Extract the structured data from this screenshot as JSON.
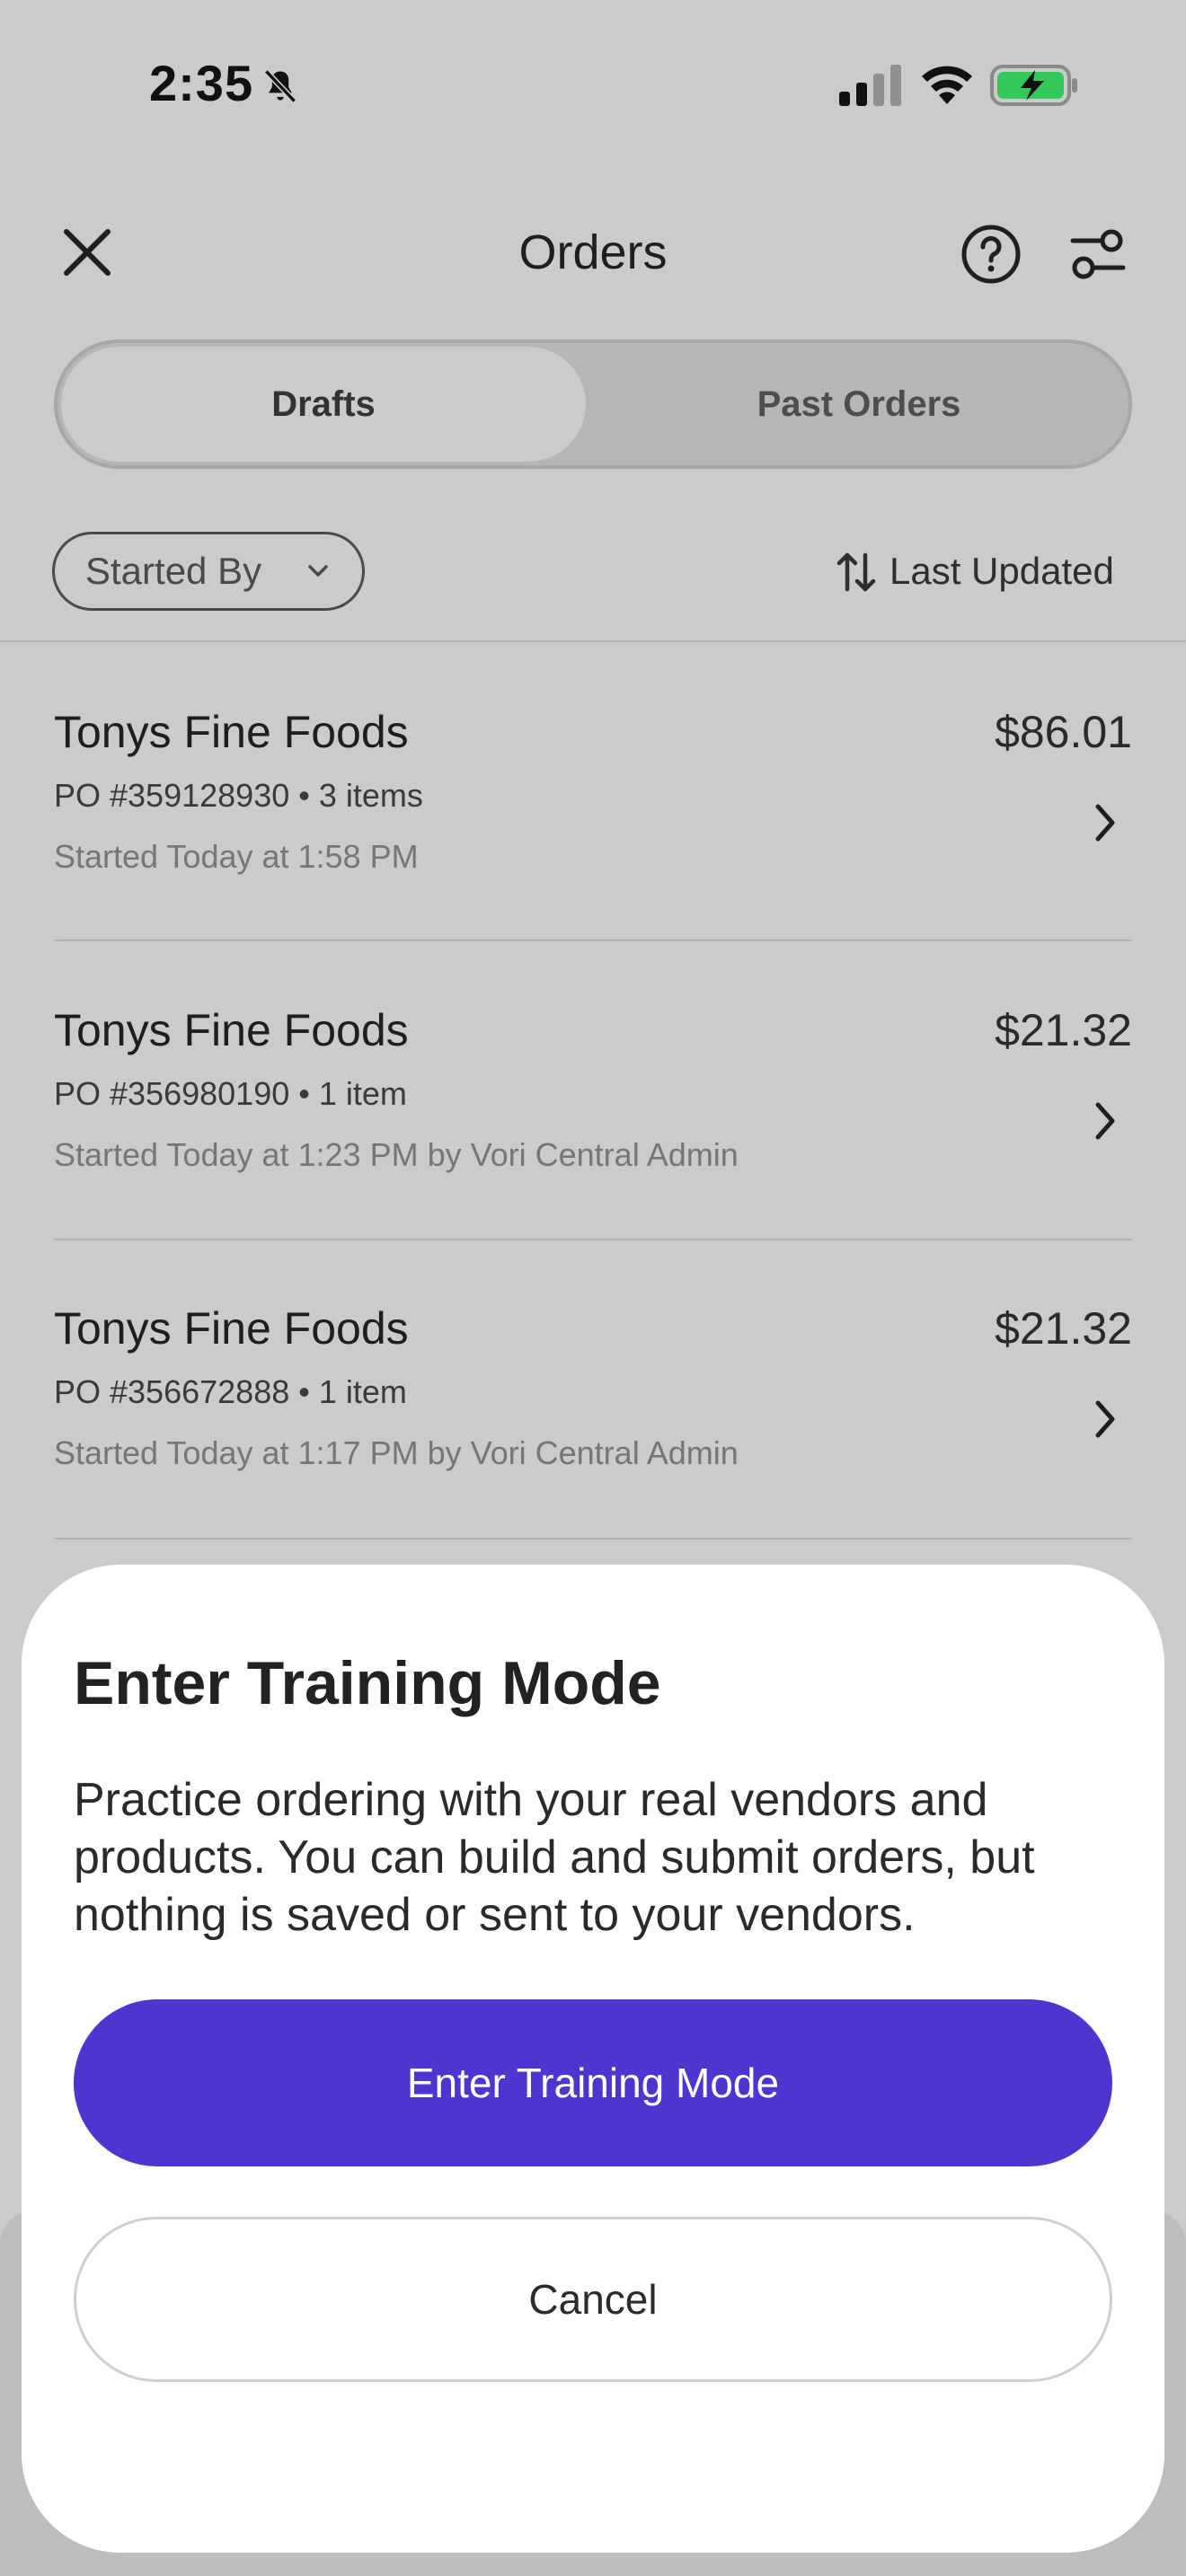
{
  "status_bar": {
    "time": "2:35"
  },
  "header": {
    "title": "Orders"
  },
  "tabs": [
    {
      "label": "Drafts",
      "selected": true
    },
    {
      "label": "Past Orders",
      "selected": false
    }
  ],
  "filters": {
    "started_by_label": "Started By",
    "sort_label": "Last Updated"
  },
  "orders": [
    {
      "vendor": "Tonys Fine Foods",
      "amount": "$86.01",
      "po_line": "PO #359128930 • 3 items",
      "started_line": "Started Today at 1:58 PM"
    },
    {
      "vendor": "Tonys Fine Foods",
      "amount": "$21.32",
      "po_line": "PO #356980190 • 1 item",
      "started_line": "Started Today at 1:23 PM by Vori Central Admin"
    },
    {
      "vendor": "Tonys Fine Foods",
      "amount": "$21.32",
      "po_line": "PO #356672888 • 1 item",
      "started_line": "Started Today at 1:17 PM by Vori Central Admin"
    }
  ],
  "sheet": {
    "title": "Enter Training Mode",
    "body": "Practice ordering with your real vendors and products. You can build and submit orders, but nothing is saved or sent to your vendors.",
    "primary_label": "Enter Training Mode",
    "secondary_label": "Cancel"
  },
  "colors": {
    "accent": "#5034cf",
    "overlay_background": "#cbcbcb",
    "battery_charge": "#34c759"
  },
  "icons": {
    "close": "close-icon",
    "help": "help-icon",
    "filter": "filter-icon",
    "sort": "sort-icon",
    "chevron_down": "chevron-down-icon",
    "chevron_right": "chevron-right-icon",
    "bell_muted": "bell-muted-icon",
    "signal": "signal-icon",
    "wifi": "wifi-icon",
    "battery": "battery-charging-icon"
  }
}
